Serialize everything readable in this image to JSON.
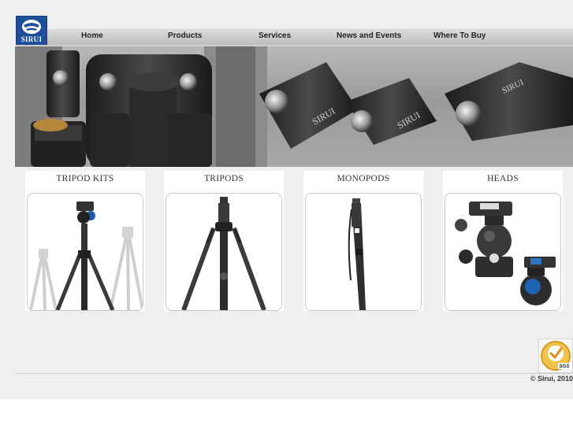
{
  "brand": {
    "logo_text": "SIRUI",
    "color": "#1f4e9a"
  },
  "nav": {
    "items": [
      {
        "label": "Home"
      },
      {
        "label": "Products"
      },
      {
        "label": "Services"
      },
      {
        "label": "News and Events"
      },
      {
        "label": "Where To Buy"
      }
    ]
  },
  "banner": {
    "engraved_text": "SIRUI"
  },
  "products": [
    {
      "title": "TRIPOD KITS"
    },
    {
      "title": "TRIPODS"
    },
    {
      "title": "MONOPODS"
    },
    {
      "title": "HEADS"
    }
  ],
  "footer": {
    "badge_text": "SGS",
    "copyright": "© Sirui, 2010"
  }
}
